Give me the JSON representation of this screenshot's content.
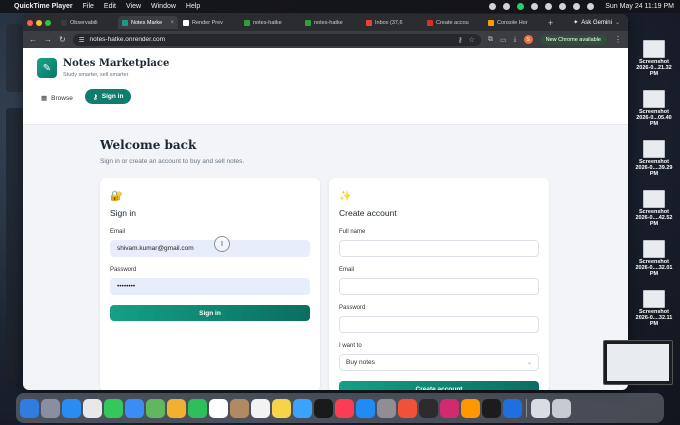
{
  "menubar": {
    "app_name": "QuickTime Player",
    "menus": [
      "File",
      "Edit",
      "View",
      "Window",
      "Help"
    ],
    "clock": "Sun May 24  11:19 PM"
  },
  "browser": {
    "tabs": [
      {
        "label": "Observabili",
        "color": "#3a3a3a",
        "active": false
      },
      {
        "label": "Notes Marke",
        "color": "#1a9c83",
        "active": true
      },
      {
        "label": "Render Prev",
        "color": "#ffffff",
        "active": false
      },
      {
        "label": "notes-hatke",
        "color": "#2ea043",
        "active": false
      },
      {
        "label": "notes-hatke",
        "color": "#2ea043",
        "active": false
      },
      {
        "label": "Inbox (37,6",
        "color": "#ea4335",
        "active": false
      },
      {
        "label": "Create accou",
        "color": "#d93025",
        "active": false
      },
      {
        "label": "Console Hor",
        "color": "#ff9900",
        "active": false
      }
    ],
    "ask_gemini": "Ask Gemini",
    "url": "notes-hatke.onrender.com",
    "update_chip": "New Chrome available",
    "profile_initial": "S"
  },
  "site": {
    "brand_title": "Notes Marketplace",
    "brand_subtitle": "Study smarter, sell smarter",
    "nav_browse": "Browse",
    "nav_signin": "Sign in"
  },
  "main": {
    "heading": "Welcome back",
    "subheading": "Sign in or create an account to buy and sell notes."
  },
  "signin": {
    "title": "Sign in",
    "email_label": "Email",
    "email_value": "shivam.kumar@gmail.com",
    "password_label": "Password",
    "password_value": "••••••••",
    "submit_label": "Sign in"
  },
  "create": {
    "title": "Create account",
    "name_label": "Full name",
    "email_label": "Email",
    "password_label": "Password",
    "intent_label": "I want to",
    "intent_value": "Buy notes",
    "submit_label": "Create account"
  },
  "desktop_files": [
    {
      "name": "Screenshot",
      "date": "2026-0...21.32 PM"
    },
    {
      "name": "Screenshot",
      "date": "2026-0...05.40 PM"
    },
    {
      "name": "Screenshot",
      "date": "2026-0....39.29 PM"
    },
    {
      "name": "Screenshot",
      "date": "2026-0....42.52 PM"
    },
    {
      "name": "Screenshot",
      "date": "2026-0....32.01 PM"
    },
    {
      "name": "Screenshot",
      "date": "2026-0....32.11 PM"
    }
  ],
  "dock": [
    {
      "name": "finder-icon",
      "color": "#2f7de1"
    },
    {
      "name": "launchpad-icon",
      "color": "#8a8fa0"
    },
    {
      "name": "safari-icon",
      "color": "#2a8cf0"
    },
    {
      "name": "chrome-icon",
      "color": "#e8e8e8"
    },
    {
      "name": "messages-icon",
      "color": "#34c759"
    },
    {
      "name": "mail-icon",
      "color": "#3b8cf5"
    },
    {
      "name": "maps-icon",
      "color": "#5fb85f"
    },
    {
      "name": "photos-icon",
      "color": "#f0b030"
    },
    {
      "name": "facetime-icon",
      "color": "#2fbf5a"
    },
    {
      "name": "calendar-icon",
      "color": "#ffffff"
    },
    {
      "name": "contacts-icon",
      "color": "#b08a60"
    },
    {
      "name": "reminders-icon",
      "color": "#f2f2f2"
    },
    {
      "name": "notes-icon",
      "color": "#f7d24b"
    },
    {
      "name": "freeform-icon",
      "color": "#3aa3ff"
    },
    {
      "name": "tv-icon",
      "color": "#1a1a1a"
    },
    {
      "name": "music-icon",
      "color": "#fa3c55"
    },
    {
      "name": "appstore-icon",
      "color": "#1f8cf5"
    },
    {
      "name": "settings-icon",
      "color": "#8e8e93"
    },
    {
      "name": "swift-icon",
      "color": "#f05138"
    },
    {
      "name": "cube-icon",
      "color": "#2c2c2e"
    },
    {
      "name": "intellij-icon",
      "color": "#d12a6e"
    },
    {
      "name": "sublime-icon",
      "color": "#ff9800"
    },
    {
      "name": "terminal-icon",
      "color": "#1c1c1c"
    },
    {
      "name": "quicktime-icon",
      "color": "#1f6fe0"
    },
    {
      "name": "folder-icon",
      "color": "#d8dde4"
    },
    {
      "name": "trash-icon",
      "color": "#c7cbd1"
    }
  ]
}
